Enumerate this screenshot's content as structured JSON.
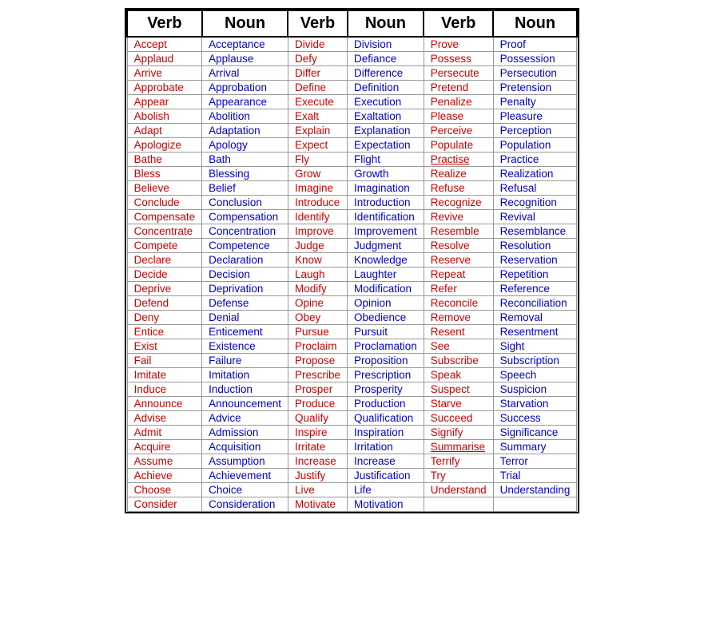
{
  "columns": [
    {
      "header1": "Verb",
      "header2": "Noun",
      "rows": [
        [
          "Accept",
          "Acceptance"
        ],
        [
          "Applaud",
          "Applause"
        ],
        [
          "Arrive",
          "Arrival"
        ],
        [
          "Approbate",
          "Approbation"
        ],
        [
          "Appear",
          "Appearance"
        ],
        [
          "Abolish",
          "Abolition"
        ],
        [
          "Adapt",
          "Adaptation"
        ],
        [
          "Apologize",
          "Apology"
        ],
        [
          "Bathe",
          "Bath"
        ],
        [
          "Bless",
          "Blessing"
        ],
        [
          "Believe",
          "Belief"
        ],
        [
          "Conclude",
          "Conclusion"
        ],
        [
          "Compensate",
          "Compensation"
        ],
        [
          "Concentrate",
          "Concentration"
        ],
        [
          "Compete",
          "Competence"
        ],
        [
          "Declare",
          "Declaration"
        ],
        [
          "Decide",
          "Decision"
        ],
        [
          "Deprive",
          "Deprivation"
        ],
        [
          "Defend",
          "Defense"
        ],
        [
          "Deny",
          "Denial"
        ],
        [
          "Entice",
          "Enticement"
        ],
        [
          "Exist",
          "Existence"
        ],
        [
          "Fail",
          "Failure"
        ],
        [
          "Imitate",
          "Imitation"
        ],
        [
          "Induce",
          "Induction"
        ],
        [
          "Announce",
          "Announcement"
        ],
        [
          "Advise",
          "Advice"
        ],
        [
          "Admit",
          "Admission"
        ],
        [
          "Acquire",
          "Acquisition"
        ],
        [
          "Assume",
          "Assumption"
        ],
        [
          "Achieve",
          "Achievement"
        ],
        [
          "Choose",
          "Choice"
        ],
        [
          "Consider",
          "Consideration"
        ]
      ]
    },
    {
      "header1": "Verb",
      "header2": "Noun",
      "rows": [
        [
          "Divide",
          "Division"
        ],
        [
          "Defy",
          "Defiance"
        ],
        [
          "Differ",
          "Difference"
        ],
        [
          "Define",
          "Definition"
        ],
        [
          "Execute",
          "Execution"
        ],
        [
          "Exalt",
          "Exaltation"
        ],
        [
          "Explain",
          "Explanation"
        ],
        [
          "Expect",
          "Expectation"
        ],
        [
          "Fly",
          "Flight"
        ],
        [
          "Grow",
          "Growth"
        ],
        [
          "Imagine",
          "Imagination"
        ],
        [
          "Introduce",
          "Introduction"
        ],
        [
          "Identify",
          "Identification"
        ],
        [
          "Improve",
          "Improvement"
        ],
        [
          "Judge",
          "Judgment"
        ],
        [
          "Know",
          "Knowledge"
        ],
        [
          "Laugh",
          "Laughter"
        ],
        [
          "Modify",
          "Modification"
        ],
        [
          "Opine",
          "Opinion"
        ],
        [
          "Obey",
          "Obedience"
        ],
        [
          "Pursue",
          "Pursuit"
        ],
        [
          "Proclaim",
          "Proclamation"
        ],
        [
          "Propose",
          "Proposition"
        ],
        [
          "Prescribe",
          "Prescription"
        ],
        [
          "Prosper",
          "Prosperity"
        ],
        [
          "Produce",
          "Production"
        ],
        [
          "Qualify",
          "Qualification"
        ],
        [
          "Inspire",
          "Inspiration"
        ],
        [
          "Irritate",
          "Irritation"
        ],
        [
          "Increase",
          "Increase"
        ],
        [
          "Justify",
          "Justification"
        ],
        [
          "Live",
          "Life"
        ],
        [
          "Motivate",
          "Motivation"
        ]
      ]
    },
    {
      "header1": "Verb",
      "header2": "Noun",
      "rows": [
        [
          "Prove",
          "Proof"
        ],
        [
          "Possess",
          "Possession"
        ],
        [
          "Persecute",
          "Persecution"
        ],
        [
          "Pretend",
          "Pretension"
        ],
        [
          "Penalize",
          "Penalty"
        ],
        [
          "Please",
          "Pleasure"
        ],
        [
          "Perceive",
          "Perception"
        ],
        [
          "Populate",
          "Population"
        ],
        [
          "Practise",
          "Practice"
        ],
        [
          "Realize",
          "Realization"
        ],
        [
          "Refuse",
          "Refusal"
        ],
        [
          "Recognize",
          "Recognition"
        ],
        [
          "Revive",
          "Revival"
        ],
        [
          "Resemble",
          "Resemblance"
        ],
        [
          "Resolve",
          "Resolution"
        ],
        [
          "Reserve",
          "Reservation"
        ],
        [
          "Repeat",
          "Repetition"
        ],
        [
          "Refer",
          "Reference"
        ],
        [
          "Reconcile",
          "Reconciliation"
        ],
        [
          "Remove",
          "Removal"
        ],
        [
          "Resent",
          "Resentment"
        ],
        [
          "See",
          "Sight"
        ],
        [
          "Subscribe",
          "Subscription"
        ],
        [
          "Speak",
          "Speech"
        ],
        [
          "Suspect",
          "Suspicion"
        ],
        [
          "Starve",
          "Starvation"
        ],
        [
          "Succeed",
          "Success"
        ],
        [
          "Signify",
          "Significance"
        ],
        [
          "Summarise",
          "Summary"
        ],
        [
          "Terrify",
          "Terror"
        ],
        [
          "Try",
          "Trial"
        ],
        [
          "Understand",
          "Understanding"
        ],
        [
          "",
          ""
        ]
      ]
    }
  ]
}
